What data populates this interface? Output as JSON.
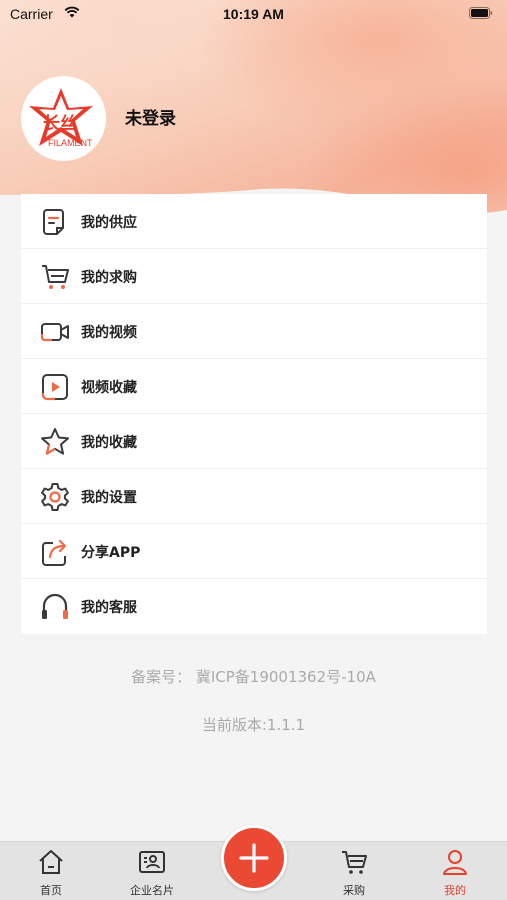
{
  "status_bar": {
    "carrier": "Carrier",
    "time": "10:19 AM"
  },
  "profile": {
    "logo_text": "长丝",
    "logo_subtext": "FILAMENT",
    "login_status": "未登录"
  },
  "menu": {
    "items": [
      {
        "label": "我的供应",
        "icon": "supply-document-icon"
      },
      {
        "label": "我的求购",
        "icon": "shopping-cart-icon"
      },
      {
        "label": "我的视频",
        "icon": "video-camera-icon"
      },
      {
        "label": "视频收藏",
        "icon": "video-play-icon"
      },
      {
        "label": "我的收藏",
        "icon": "star-icon"
      },
      {
        "label": "我的设置",
        "icon": "gear-icon"
      },
      {
        "label": "分享APP",
        "icon": "share-icon"
      },
      {
        "label": "我的客服",
        "icon": "headset-icon"
      }
    ]
  },
  "footer": {
    "icp": "备案号：  冀ICP备19001362号-10A",
    "version": "当前版本:1.1.1"
  },
  "tabbar": {
    "home": "首页",
    "business_card": "企业名片",
    "purchase": "采购",
    "mine": "我的",
    "active": "mine"
  },
  "colors": {
    "accent": "#ea4a34",
    "icon_dark": "#3a3a3a",
    "icon_accent": "#ef6b47",
    "muted_text": "#aaaaaa",
    "tabbar_bg": "#e3e3e3"
  }
}
